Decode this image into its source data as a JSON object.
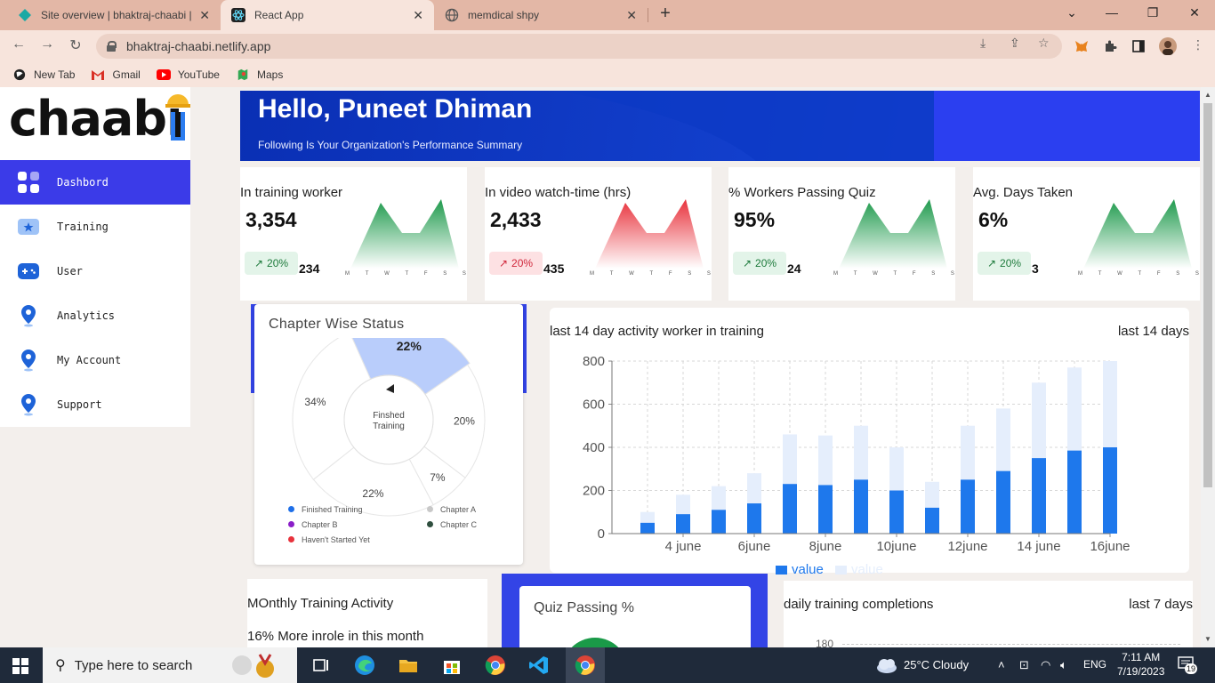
{
  "browser": {
    "tabs": [
      {
        "title": "Site overview | bhaktraj-chaabi | N",
        "close": "✕"
      },
      {
        "title": "React App",
        "close": "✕"
      },
      {
        "title": "memdical shpy",
        "close": "✕"
      }
    ],
    "new_tab": "+",
    "url": "bhaktraj-chaabi.netlify.app",
    "bookmarks": [
      "New Tab",
      "Gmail",
      "YouTube",
      "Maps"
    ]
  },
  "sidebar": {
    "logo": "chaabi",
    "items": [
      {
        "label": "Dashbord",
        "icon": "dashboard-icon",
        "active": true
      },
      {
        "label": "Training",
        "icon": "training-icon"
      },
      {
        "label": "User",
        "icon": "user-icon"
      },
      {
        "label": "Analytics",
        "icon": "location-pin-icon"
      },
      {
        "label": "My Account",
        "icon": "location-pin-icon"
      },
      {
        "label": "Support",
        "icon": "location-pin-icon"
      }
    ]
  },
  "hero": {
    "greeting": "Hello, Puneet Dhiman",
    "subtitle": "Following Is Your Organization's Performance Summary"
  },
  "stats": [
    {
      "label": "In training worker",
      "value": "3,354",
      "badge": "20%",
      "sub": "234",
      "trend": "green"
    },
    {
      "label": "In video watch-time (hrs)",
      "value": "2,433",
      "badge": "20%",
      "sub": "435",
      "trend": "red"
    },
    {
      "label": "% Workers Passing Quiz",
      "value": "95%",
      "badge": "20%",
      "sub": "24",
      "trend": "green"
    },
    {
      "label": "Avg. Days Taken",
      "value": "6%",
      "badge": "20%",
      "sub": "3",
      "trend": "green"
    }
  ],
  "spark_days": [
    "M",
    "T",
    "W",
    "T",
    "F",
    "S",
    "S"
  ],
  "chapter_status": {
    "title": "Chapter Wise Status",
    "center_label_1": "Finshed",
    "center_label_2": "Training",
    "slices": [
      {
        "label": "22%",
        "value": 22,
        "color": "#b9cdfb"
      },
      {
        "label": "20%",
        "value": 20,
        "color": "#ffffff"
      },
      {
        "label": "7%",
        "value": 7,
        "color": "#ffffff"
      },
      {
        "label": "22%",
        "value": 22,
        "color": "#ffffff"
      },
      {
        "label": "34%",
        "value": 29,
        "color": "#ffffff"
      }
    ],
    "legend": [
      {
        "label": "Finished Training",
        "color": "#1e6fe8"
      },
      {
        "label": "Chapter A",
        "color": "#c8c8c8"
      },
      {
        "label": "Chapter B",
        "color": "#8a1ec8"
      },
      {
        "label": "Chapter C",
        "color": "#2f4f3f"
      },
      {
        "label": "Haven't Started Yet",
        "color": "#e8323c"
      }
    ]
  },
  "chart_data": {
    "type": "bar",
    "title": "last 14 day activity worker in training",
    "range_label": "last 14 days",
    "x": [
      3,
      4,
      5,
      6,
      7,
      8,
      9,
      10,
      11,
      12,
      13,
      14,
      15,
      16
    ],
    "tick_labels": [
      "4 june",
      "6june",
      "8june",
      "10june",
      "12june",
      "14 june",
      "16june"
    ],
    "ylim": [
      0,
      800
    ],
    "yticks": [
      0,
      200,
      400,
      600,
      800
    ],
    "grid": true,
    "legend_position": "bottom",
    "series": [
      {
        "name": "value",
        "color": "#1e78ec",
        "values": [
          50,
          90,
          110,
          140,
          230,
          225,
          250,
          200,
          120,
          250,
          290,
          350,
          385,
          400
        ]
      },
      {
        "name": "value",
        "color": "#e5eefc",
        "values": [
          100,
          180,
          220,
          280,
          460,
          455,
          500,
          400,
          240,
          500,
          580,
          700,
          770,
          800
        ]
      }
    ]
  },
  "monthly": {
    "title": "MOnthly Training Activity",
    "subtitle": "16% More inrole in this month"
  },
  "quiz": {
    "title": "Quiz Passing %"
  },
  "daily": {
    "title": "daily training completions",
    "range": "last 7 days",
    "first_tick": "180"
  },
  "taskbar": {
    "search_placeholder": "Type here to search",
    "weather": "25°C  Cloudy",
    "lang": "ENG",
    "time": "7:11 AM",
    "date": "7/19/2023",
    "notifications": "19"
  }
}
